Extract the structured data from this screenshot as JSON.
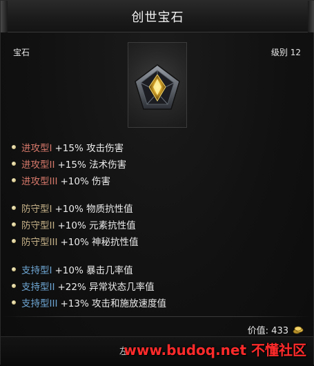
{
  "window": {
    "title": "创世宝石"
  },
  "item": {
    "type_label": "宝石",
    "level_label": "级别 12",
    "gem_icon": "pentagon-gem-icon",
    "price_label": "价值: 433",
    "currency_icon": "gold-coin-icon"
  },
  "stats": {
    "attack": [
      {
        "tier": "进攻型I",
        "value": "+15% 攻击伤害"
      },
      {
        "tier": "进攻型II",
        "value": "+15% 法术伤害"
      },
      {
        "tier": "进攻型III",
        "value": "+10% 伤害"
      }
    ],
    "defense": [
      {
        "tier": "防守型I",
        "value": "+10% 物质抗性值"
      },
      {
        "tier": "防守型II",
        "value": "+10% 元素抗性值"
      },
      {
        "tier": "防守型III",
        "value": "+10% 神秘抗性值"
      }
    ],
    "support": [
      {
        "tier": "支持型I",
        "value": "+10% 暴击几率值"
      },
      {
        "tier": "支持型II",
        "value": "+22% 异常状态几率值"
      },
      {
        "tier": "支持型III",
        "value": "+13% 攻击和施放速度值"
      }
    ]
  },
  "footer": {
    "hint": "左",
    "watermark": "www.budoq.net 不懂社区"
  },
  "colors": {
    "attack_tier": "#d6786a",
    "defense_tier": "#c5b188",
    "support_tier": "#6ea6d3",
    "watermark": "#ff2b2b"
  }
}
